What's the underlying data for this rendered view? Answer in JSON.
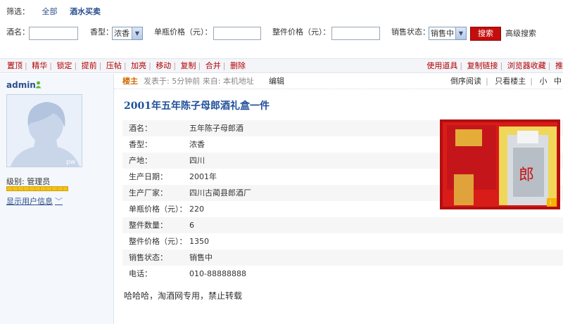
{
  "filter": {
    "label": "筛选：",
    "options": [
      "全部",
      "酒水买卖"
    ],
    "fields": {
      "name_label": "酒名：",
      "type_label": "香型：",
      "type_value": "浓香",
      "unit_price_label": "单瓶价格（元）：",
      "box_price_label": "整件价格（元）：",
      "status_label": "销售状态：",
      "status_value": "销售中"
    },
    "search_button": "搜索",
    "advanced_search": "高级搜索"
  },
  "toolbar": {
    "left": [
      "置顶",
      "精华",
      "锁定",
      "提前",
      "压帖",
      "加亮",
      "移动",
      "复制",
      "合并",
      "删除"
    ],
    "right": [
      "使用道具",
      "复制链接",
      "浏览器收藏",
      "推"
    ]
  },
  "user": {
    "name": "admin",
    "level_label": "级别: 管理员",
    "show_info": "显示用户信息",
    "avatar_badge": "pw"
  },
  "post": {
    "owner": "楼主",
    "meta": "发表于: 5分钟前   来自: 本机地址",
    "edit": "编辑",
    "right_links": [
      "倒序阅读",
      "只看楼主",
      "小",
      "中"
    ],
    "title": "2001年五年陈子母郎酒礼盒一件",
    "info": [
      {
        "k": "酒名：",
        "v": "五年陈子母郎酒"
      },
      {
        "k": "香型：",
        "v": "浓香"
      },
      {
        "k": "产地：",
        "v": "四川"
      },
      {
        "k": "生产日期：",
        "v": "2001年"
      },
      {
        "k": "生产厂家：",
        "v": "四川古蔺县郎酒厂"
      },
      {
        "k": "单瓶价格（元）：",
        "v": "220"
      },
      {
        "k": "整件数量：",
        "v": "6"
      },
      {
        "k": "整件价格（元）：",
        "v": "1350"
      },
      {
        "k": "销售状态：",
        "v": "销售中"
      },
      {
        "k": "电话：",
        "v": "010-88888888"
      }
    ],
    "body": "哈哈哈，淘酒网专用，禁止转载"
  },
  "colors": {
    "accent_red": "#c40d0d",
    "link_blue": "#2b4f8f",
    "title_blue": "#1f4f9a",
    "owner_orange": "#d26a00"
  }
}
